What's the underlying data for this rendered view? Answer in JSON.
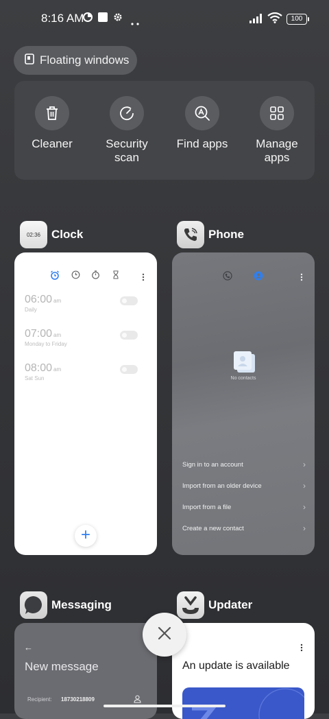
{
  "status_bar": {
    "time": "8:16 AM",
    "battery": "100"
  },
  "floating_windows": {
    "label": "Floating windows"
  },
  "tools": [
    {
      "label": "Cleaner",
      "icon": "trash-icon"
    },
    {
      "label": "Security\nscan",
      "icon": "gauge-icon"
    },
    {
      "label": "Find apps",
      "icon": "search-a-icon"
    },
    {
      "label": "Manage\napps",
      "icon": "grid-icon"
    }
  ],
  "apps": {
    "clock": {
      "name": "Clock",
      "icon_text": "02:36",
      "alarms": [
        {
          "time": "06:00",
          "ampm": "am",
          "repeat": "Daily"
        },
        {
          "time": "07:00",
          "ampm": "am",
          "repeat": "Monday to Friday"
        },
        {
          "time": "08:00",
          "ampm": "am",
          "repeat": "Sat Sun"
        }
      ],
      "add": "+"
    },
    "phone": {
      "name": "Phone",
      "empty_text": "No contacts",
      "options": [
        "Sign in to an account",
        "Import from an older device",
        "Import from a file",
        "Create a new contact"
      ]
    },
    "messaging": {
      "name": "Messaging",
      "title": "New message",
      "recipient_label": "Recipient:",
      "recipient_value": "18730218809"
    },
    "updater": {
      "name": "Updater",
      "title": "An update is available"
    }
  },
  "colors": {
    "accent": "#2f7ff0",
    "background": "#38393c",
    "update_banner": "#3a58c9"
  }
}
